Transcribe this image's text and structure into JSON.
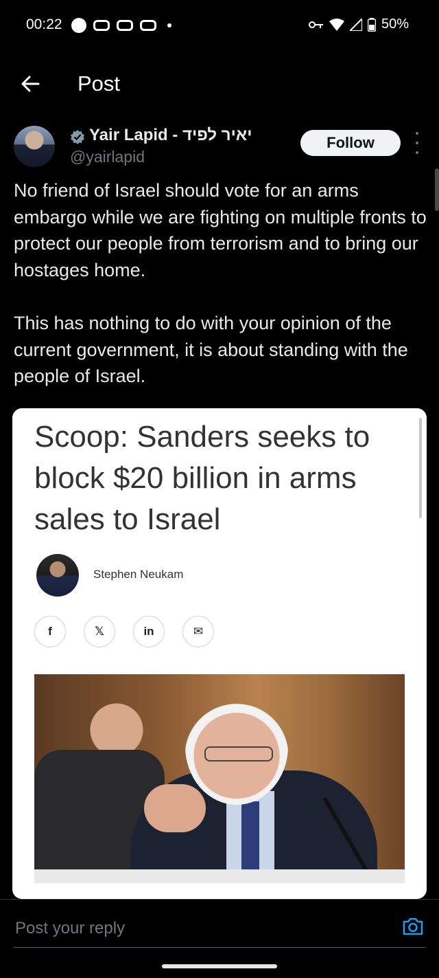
{
  "status_bar": {
    "time": "00:22",
    "battery": "50%"
  },
  "header": {
    "title": "Post"
  },
  "post": {
    "author_name": "Yair Lapid - יאיר לפיד",
    "handle": "@yairlapid",
    "follow_label": "Follow",
    "paragraphs": [
      "No friend of Israel should vote for an arms embargo while we are fighting on multiple fronts to protect our people from terrorism and to bring our hostages home.",
      "This has nothing to do with your opinion of the current government, it is about standing with the people of Israel."
    ]
  },
  "card": {
    "headline": "Scoop: Sanders seeks to block $20 billion in arms sales to Israel",
    "byline": "Stephen Neukam",
    "share_icons": [
      "facebook-icon",
      "x-icon",
      "linkedin-icon",
      "email-icon"
    ],
    "share_glyphs": [
      "f",
      "𝕏",
      "in",
      "✉"
    ]
  },
  "reply": {
    "placeholder": "Post your reply"
  },
  "colors": {
    "background": "#000000",
    "text_primary": "#e7e9ea",
    "text_secondary": "#71767b",
    "verified": "#829aab",
    "accent": "#1d9bf0"
  }
}
